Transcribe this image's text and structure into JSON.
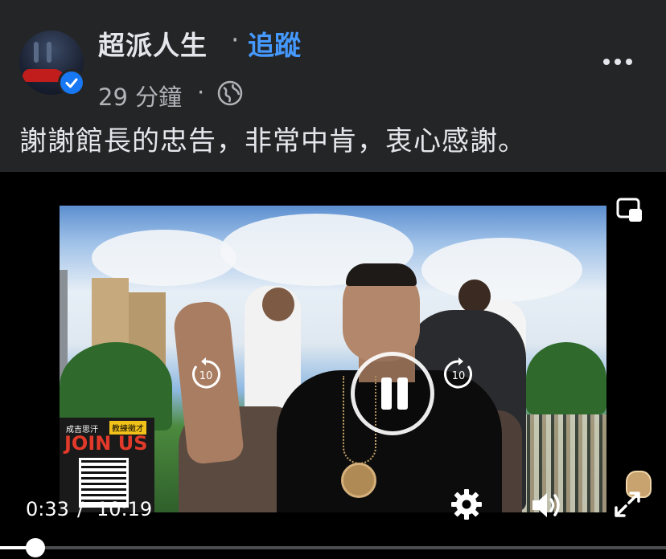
{
  "post": {
    "author": "超派人生",
    "separator": "·",
    "follow_label": "追蹤",
    "time": "29 分鐘",
    "time_separator": "·",
    "privacy_icon": "globe-icon",
    "caption": "謝謝館長的忠告，非常中肯，衷心感謝。",
    "verified": true
  },
  "video": {
    "promo": {
      "top_text": "成吉思汗",
      "badge_text": "教練徵才",
      "join_text": "JOIN US"
    },
    "skip_back_label": "10",
    "skip_forward_label": "10",
    "state": "playing",
    "current_time": "0:33",
    "time_separator": "/",
    "duration": "10:19",
    "progress_fraction": 0.053
  },
  "colors": {
    "background": "#242526",
    "accent": "#4599ff",
    "verified": "#1877f2"
  }
}
